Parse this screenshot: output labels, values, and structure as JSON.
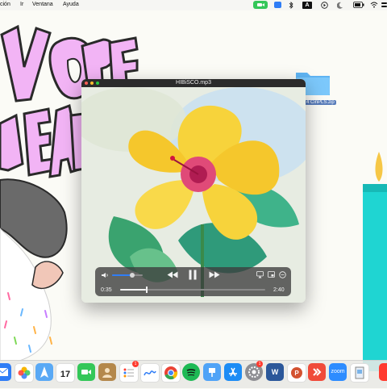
{
  "menubar": {
    "items": [
      "ción",
      "Ir",
      "Ventana",
      "Ayuda"
    ],
    "tray": {
      "keyboard_letter": "A"
    }
  },
  "folder": {
    "label": "4 CinPLS.zip"
  },
  "player": {
    "title": "HIBiSCO.mp3",
    "elapsed": "0:35",
    "remaining": "2:40",
    "volume_level": 0.65,
    "progress": 0.18
  },
  "dock": {
    "calendar_day": "17",
    "zoom_label": "zoom",
    "word_label": "W",
    "badge_reminders": "1",
    "badge_settings": "1"
  },
  "colors": {
    "accent_blue": "#2f7df6",
    "facetime_green": "#34c759",
    "candle_cyan": "#1fd5d2"
  }
}
